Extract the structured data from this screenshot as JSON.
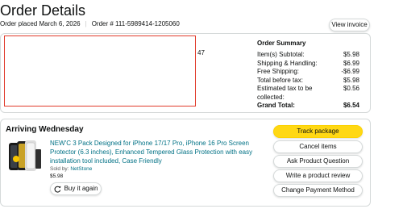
{
  "page": {
    "title": "Order Details"
  },
  "order": {
    "placed": "Order placed March 6, 2026",
    "number": "Order # 111-5989414-1205060",
    "view_invoice": "View invoice"
  },
  "partial_text": "47",
  "summary": {
    "title": "Order Summary",
    "rows": [
      {
        "label": "Item(s) Subtotal:",
        "value": "$5.98"
      },
      {
        "label": "Shipping & Handling:",
        "value": "$6.99"
      },
      {
        "label": "Free Shipping:",
        "value": "-$6.99"
      },
      {
        "label": "Total before tax:",
        "value": "$5.98"
      },
      {
        "label": "Estimated tax to be collected:",
        "value": "$0.56"
      }
    ],
    "grand_total_label": "Grand Total:",
    "grand_total_value": "$6.54"
  },
  "shipment": {
    "arriving": "Arriving Wednesday",
    "product_title": "NEW'C 3 Pack Designed for iPhone 17/17 Pro, iPhone 16 Pro Screen Protector (6.3 inches), Enhanced Tempered Glass Protection with easy installation tool included, Case Friendly",
    "sold_by_label": "Sold by:",
    "seller": "NetStone",
    "price": "$5.98",
    "buy_again": "Buy it again"
  },
  "actions": {
    "track": "Track package",
    "cancel": "Cancel items",
    "question": "Ask Product Question",
    "review": "Write a product review",
    "payment": "Change Payment Method"
  },
  "colors": {
    "accent_yellow": "#ffd814",
    "link": "#007185",
    "redaction_border": "#e03a2a"
  }
}
